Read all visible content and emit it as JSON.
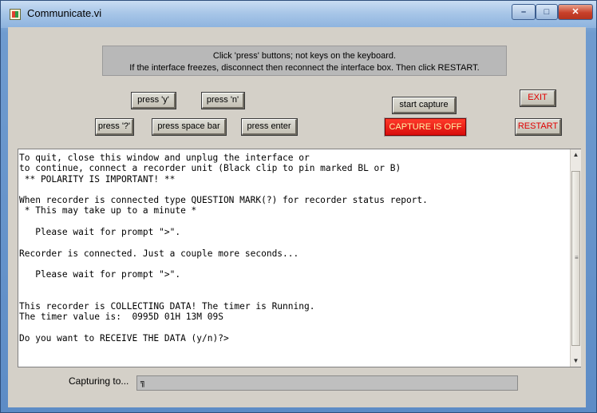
{
  "window": {
    "title": "Communicate.vi"
  },
  "banner": {
    "line1": "Click 'press' buttons; not keys on the keyboard.",
    "line2": "If the interface freezes, disconnect then reconnect the interface box. Then click RESTART."
  },
  "buttons": {
    "press_y": "press 'y'",
    "press_n": "press 'n'",
    "press_q": "press '?'",
    "press_space": "press space bar",
    "press_enter": "press enter",
    "start_capture": "start capture",
    "exit": "EXIT",
    "restart": "RESTART"
  },
  "capture_status": "CAPTURE IS OFF",
  "console_lines": [
    "To quit, close this window and unplug the interface or",
    "to continue, connect a recorder unit (Black clip to pin marked BL or B)",
    " ** POLARITY IS IMPORTANT! **",
    "",
    "When recorder is connected type QUESTION MARK(?) for recorder status report.",
    " * This may take up to a minute *",
    "",
    "   Please wait for prompt \">\".",
    "",
    "Recorder is connected. Just a couple more seconds...",
    "",
    "   Please wait for prompt \">\".",
    "",
    "",
    "This recorder is COLLECTING DATA! The timer is Running.",
    "The timer value is:  0995D 01H 13M 09S",
    "",
    "Do you want to RECEIVE THE DATA (y/n)?>"
  ],
  "capture": {
    "label": "Capturing to...",
    "value": ""
  },
  "icons": {
    "app": "labview-vi-icon",
    "minimize": "minimize-icon",
    "maximize": "maximize-icon",
    "close": "close-icon"
  },
  "colors": {
    "capture_off": "#e01010",
    "exit_text": "#e00000"
  }
}
